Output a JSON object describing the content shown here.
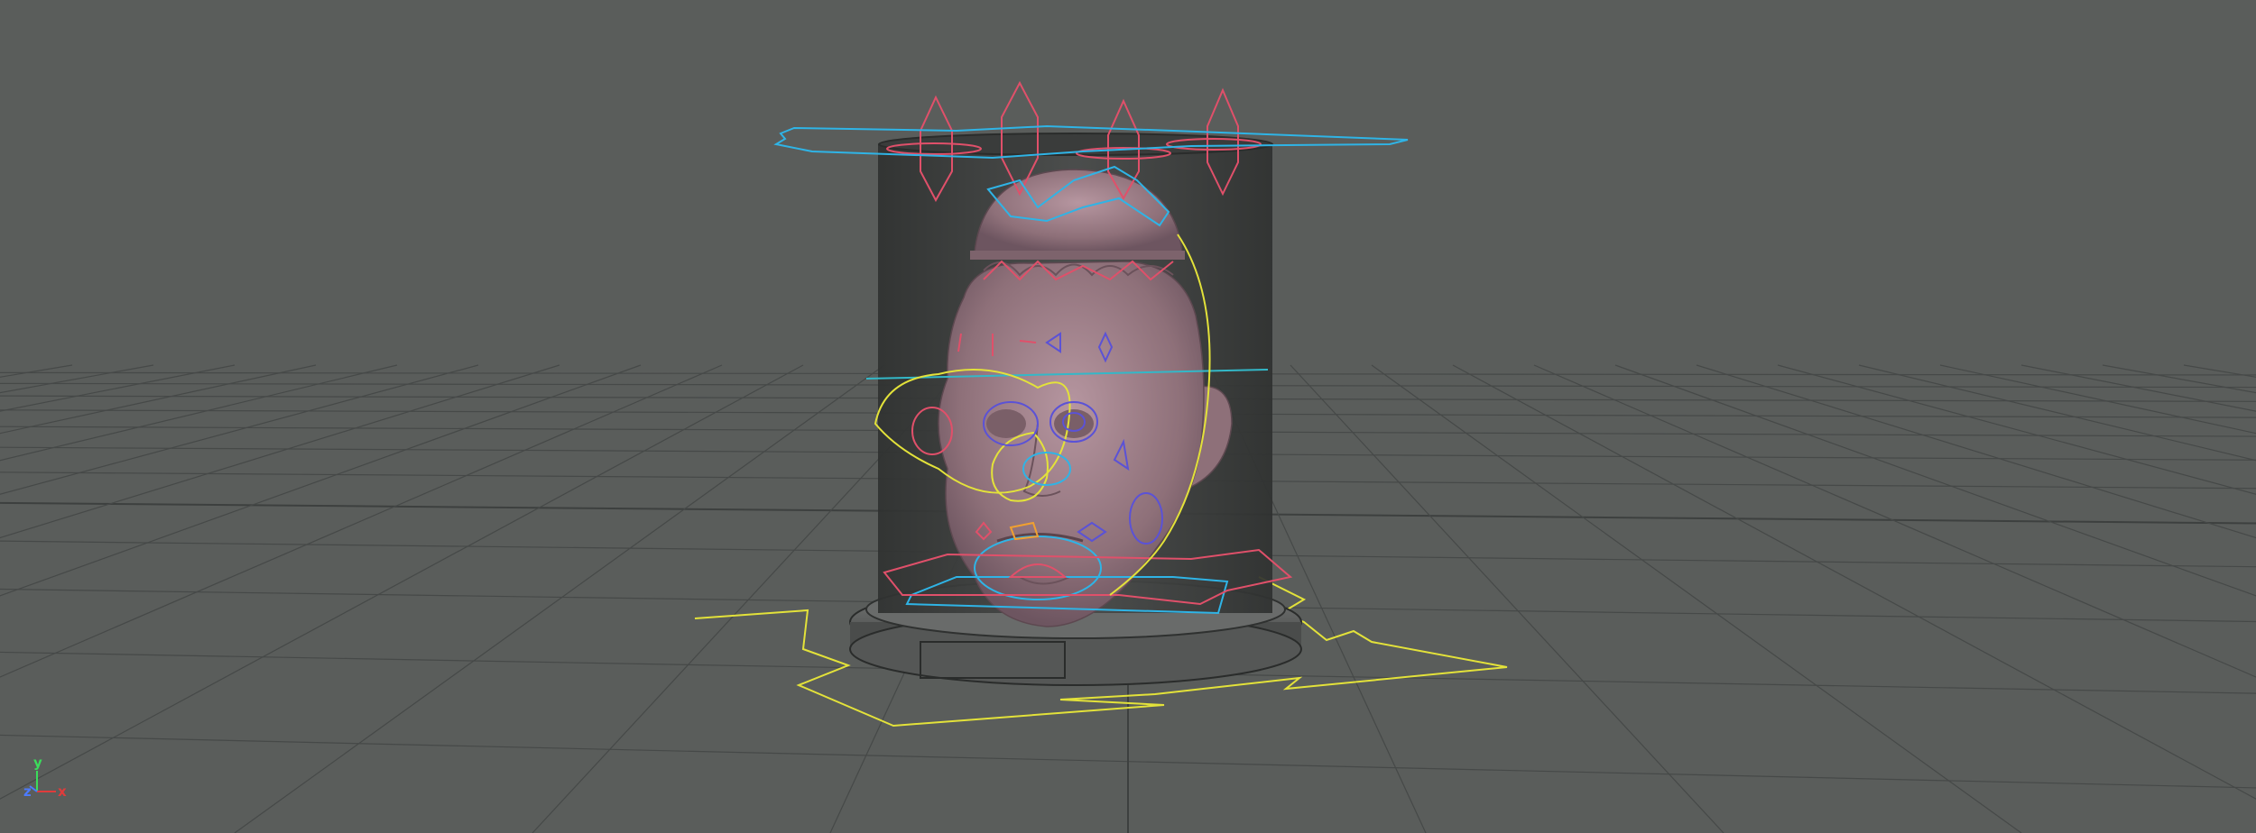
{
  "viewport": {
    "background": "#5a5d5b",
    "grid_color": "#444746",
    "grid_highlight": "#7e8280"
  },
  "axis_gizmo": {
    "y_label": "y",
    "z_label": "z",
    "x_label": "x",
    "y_color": "#3bdc5b",
    "z_color": "#4c7bff",
    "x_color": "#e03b3b"
  },
  "colors": {
    "head_skin": "#9c7f88",
    "controls_red": "#e0506a",
    "controls_blue": "#2fb4e6",
    "controls_yellow": "#e3e23a",
    "controls_purple": "#5b52d6",
    "cylinder": "#3f4140",
    "base": "#6a6c6b"
  }
}
